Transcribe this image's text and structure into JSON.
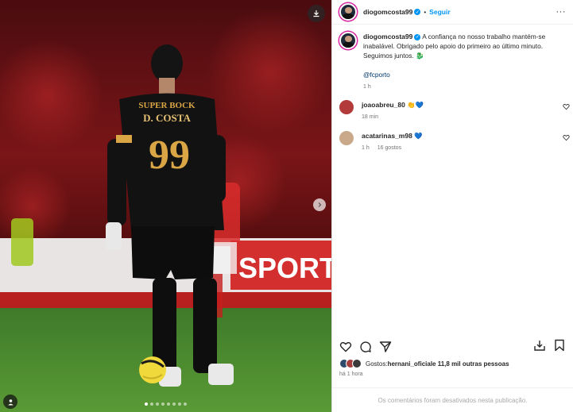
{
  "post": {
    "author": "diogomcosta99",
    "follow_label": "Seguir",
    "separator": "•",
    "more_label": "···",
    "caption": "A confiança no nosso trabalho mantém-se inabalável. Obrigado pelo apoio do primeiro ao último minuto. Seguimos juntos. 🐉",
    "mention": "@fcporto",
    "caption_time": "1 h"
  },
  "photo": {
    "jersey_sponsor": "SUPER BOCK",
    "jersey_name": "D. COSTA",
    "jersey_number": "99",
    "banner_text": "SPORT",
    "carousel_count": 8,
    "carousel_active_index": 0
  },
  "comments": [
    {
      "user": "joaoabreu_80",
      "text": "👏💙",
      "time": "18 min",
      "likes": ""
    },
    {
      "user": "acatarinas_m98",
      "text": "💙",
      "time": "1 h",
      "likes": "16 gostos"
    }
  ],
  "likes": {
    "prefix": "Gostos: ",
    "first_user": "hernani_oficial",
    "rest": " e 11,8 mil outras pessoas"
  },
  "post_time": "há 1 hora",
  "comments_disabled": "Os comentários foram desativados nesta publicação.",
  "colors": {
    "accent": "#0095f6",
    "text": "#262626",
    "muted": "#737373"
  }
}
